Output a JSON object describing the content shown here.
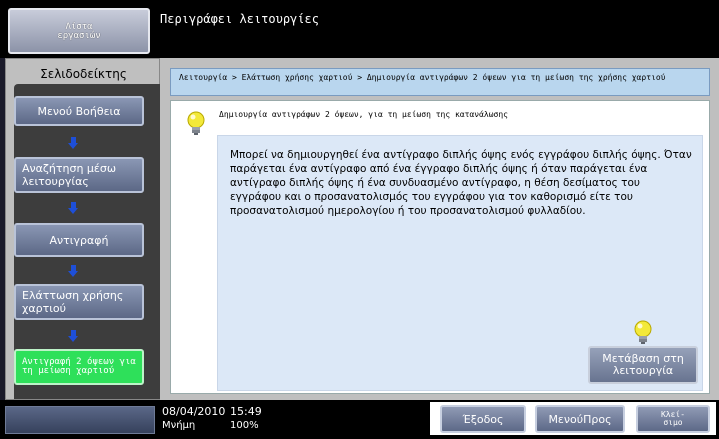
{
  "topbar": {
    "joblist_label": "Λίστα\nεργασιών",
    "title": "Περιγράφει λειτουργίες"
  },
  "left": {
    "bookmark_title": "Σελιδοδείκτης",
    "steps": [
      "Μενού Βοήθεια",
      "Αναζήτηση μέσω λειτουργίας",
      "Αντιγραφή",
      "Ελάττωση χρήσης χαρτιού",
      "Αντιγραφή 2 όψεων για τη μείωση χαρτιού"
    ]
  },
  "main": {
    "breadcrumb": "Λειτουργία > Ελάττωση χρήσης χαρτιού > Δημιουργία αντιγράφων 2 όψεων για τη μείωση της χρήσης χαρτιού",
    "subtitle": "Δημιουργία αντιγράφων 2 όψεων, για τη μείωση της κατανάλωσης",
    "description": "Μπορεί να δημιουργηθεί ένα αντίγραφο διπλής όψης ενός εγγράφου διπλής όψης. Όταν παράγεται ένα αντίγραφο από ένα έγγραφο διπλής όψης ή όταν παράγεται ένα αντίγραφο διπλής όψης ή ένα συνδυασμένο αντίγραφο, η θέση δεσίματος του εγγράφου και ο προσανατολισμός του εγγράφου για τον καθορισμό είτε του προσανατολισμού ημερολογίου ή του προσανατολισμού φυλλαδίου.",
    "goto_label": "Μετάβαση στη λειτουργία",
    "icons": [
      "lightbulb-icon",
      "lightbulb-icon"
    ]
  },
  "bottombar": {
    "date": "08/04/2010",
    "time": "15:49",
    "memory_label": "Μνήμη",
    "memory_value": "100%",
    "exit_label": "Έξοδος",
    "menu_label": "ΜενούΠρος",
    "close_label": "Κλεί-\nσιμο"
  },
  "colors": {
    "active_step": "#2ee05a",
    "arrow": "#1e4fd8",
    "breadcrumb_bg": "#b9d6ee",
    "desc_bg": "#dce8f7"
  }
}
